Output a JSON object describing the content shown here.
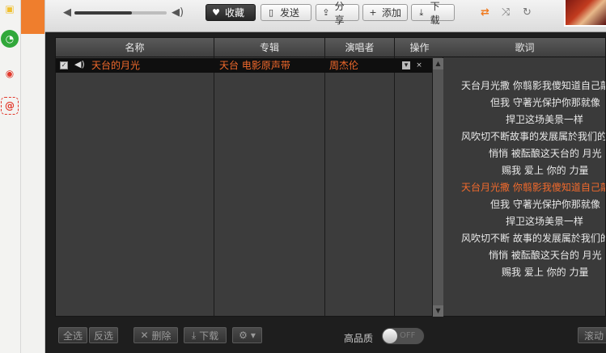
{
  "dock": {
    "icons": [
      {
        "name": "folder-icon",
        "glyph": "▣",
        "color": "#f0c030"
      },
      {
        "name": "clock-icon",
        "glyph": "◔",
        "color": "#31a83a"
      },
      {
        "name": "weibo-icon",
        "glyph": "◉",
        "color": "#e2392c"
      },
      {
        "name": "mail-icon",
        "glyph": "@",
        "color": "#e2392c"
      }
    ]
  },
  "player": {
    "volume_percent": 62,
    "buttons": {
      "favorite": "收藏",
      "send": "发送",
      "share": "分享",
      "add": "添加",
      "download": "下载"
    }
  },
  "playlist": {
    "headers": {
      "name": "名称",
      "album": "专辑",
      "artist": "演唱者",
      "action": "操作"
    },
    "tracks": [
      {
        "name": "天台的月光",
        "album": "天台 电影原声带",
        "artist": "周杰伦"
      }
    ]
  },
  "lyrics": {
    "header": "歌词",
    "lines": [
      "天台月光撒 你翦影我傻知道自己敲",
      "但我 守著光保护你那就像",
      "捍卫这场美景一样",
      "风吹切不断故事的发展属於我们的",
      "悄悄 被酝酿这天台的 月光",
      "赐我 爱上 你的 力量",
      "天台月光撒 你翦影我傻知道自己敲",
      "但我 守著光保护你那就像",
      "捍卫这场美景一样",
      "风吹切不断 故事的发展属於我们的",
      "悄悄 被酝酿这天台的 月光",
      "赐我 爱上 你的 力量"
    ],
    "active_index": 6
  },
  "bottom": {
    "select_all": "全选",
    "invert": "反选",
    "delete": "删除",
    "download": "下载",
    "quality_label": "高品质",
    "toggle_state": "OFF",
    "scroll_button": "滚动"
  },
  "colors": {
    "accent": "#f26a2c",
    "brand_orange": "#ef7e2d"
  }
}
